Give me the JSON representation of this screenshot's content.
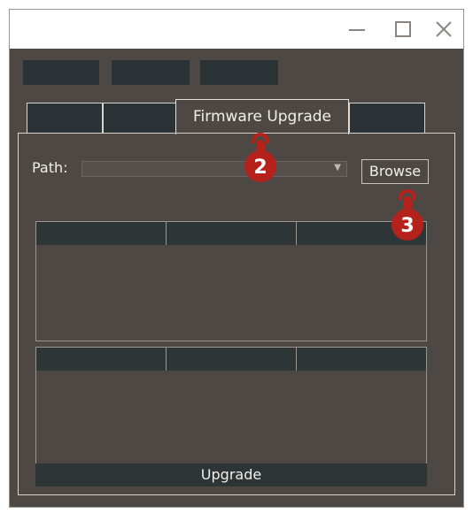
{
  "window": {
    "minimize_icon": "minimize-icon",
    "maximize_icon": "maximize-icon",
    "close_icon": "close-icon"
  },
  "toolbar": {
    "buttons": [
      "",
      "",
      ""
    ]
  },
  "tabs": {
    "items": [
      {
        "label": ""
      },
      {
        "label": ""
      },
      {
        "label": "Firmware Upgrade",
        "active": true
      },
      {
        "label": ""
      }
    ]
  },
  "firmware": {
    "path_label": "Path:",
    "path_value": "",
    "browse_label": "Browse",
    "upgrade_label": "Upgrade"
  },
  "callouts": {
    "step_tab": "2",
    "step_browse": "3"
  },
  "colors": {
    "background": "#4d4843",
    "dark_control": "#2b3336",
    "text": "#f2eee9",
    "callout": "#b5221c"
  }
}
